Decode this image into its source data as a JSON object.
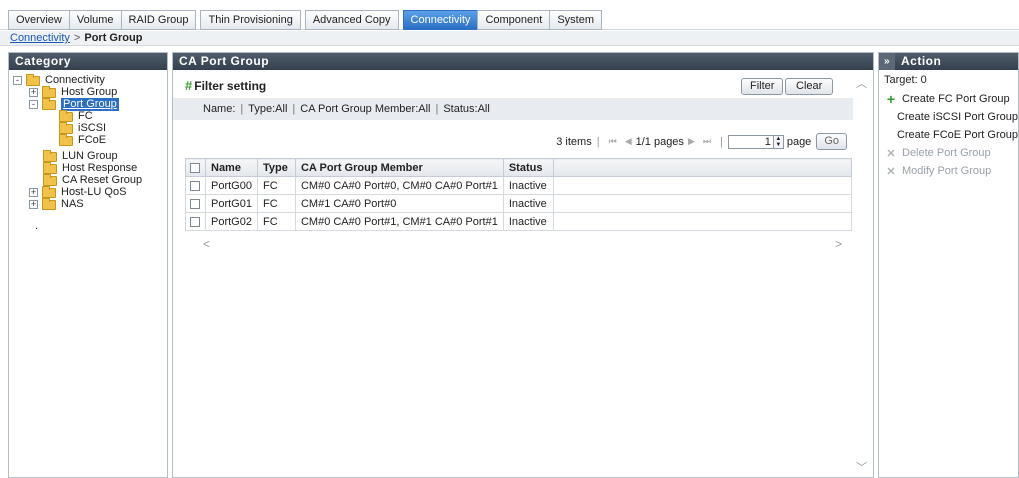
{
  "tabs": [
    {
      "label": "Overview"
    },
    {
      "label": "Volume"
    },
    {
      "label": "RAID Group"
    },
    {
      "label": "Thin Provisioning"
    },
    {
      "label": "Advanced Copy"
    },
    {
      "label": "Connectivity",
      "active": true
    },
    {
      "label": "Component"
    },
    {
      "label": "System"
    }
  ],
  "breadcrumb": {
    "parent": "Connectivity",
    "separator": ">",
    "current": "Port Group"
  },
  "category": {
    "title": "Category",
    "tree": [
      {
        "label": "Connectivity",
        "toggle": "-",
        "level": 0
      },
      {
        "label": "Host Group",
        "toggle": "+",
        "level": 1
      },
      {
        "label": "Port Group",
        "toggle": "-",
        "level": 1,
        "selected": true
      },
      {
        "label": "FC",
        "level": 2
      },
      {
        "label": "iSCSI",
        "level": 2
      },
      {
        "label": "FCoE",
        "level": 2
      },
      {
        "label": "LUN Group",
        "level": 1
      },
      {
        "label": "Host Response",
        "level": 1
      },
      {
        "label": "CA Reset Group",
        "level": 1
      },
      {
        "label": "Host-LU QoS",
        "toggle": "+",
        "level": 1
      },
      {
        "label": "NAS",
        "toggle": "+",
        "level": 1
      }
    ],
    "stray_dot": "."
  },
  "main": {
    "title": "CA Port Group",
    "filter": {
      "label": "Filter setting",
      "filter_button": "Filter",
      "clear_button": "Clear",
      "summary": [
        "Name:",
        "Type:All",
        "CA Port Group Member:All",
        "Status:All"
      ]
    },
    "pager": {
      "items": "3 items",
      "pages": "1/1 pages",
      "page_value": "1",
      "page_label": "page",
      "go_label": "Go"
    },
    "table": {
      "columns": [
        "Name",
        "Type",
        "CA Port Group Member",
        "Status"
      ],
      "rows": [
        [
          "PortG00",
          "FC",
          "CM#0 CA#0 Port#0, CM#0 CA#0 Port#1",
          "Inactive"
        ],
        [
          "PortG01",
          "FC",
          "CM#1 CA#0 Port#0",
          "Inactive"
        ],
        [
          "PortG02",
          "FC",
          "CM#0 CA#0 Port#1, CM#1 CA#0 Port#1",
          "Inactive"
        ]
      ]
    }
  },
  "action": {
    "collapse_label": "»",
    "title": "Action",
    "target": "Target: 0",
    "items": [
      {
        "label": "Create FC Port Group",
        "icon": "+",
        "enabled": true
      },
      {
        "label": "Create iSCSI Port Group",
        "icon": "",
        "enabled": true
      },
      {
        "label": "Create FCoE Port Group",
        "icon": "",
        "enabled": true
      },
      {
        "label": "Delete Port Group",
        "icon": "✕",
        "enabled": false
      },
      {
        "label": "Modify Port Group",
        "icon": "✕",
        "enabled": false
      }
    ]
  },
  "colors": {
    "active_tab": "#2b6fc4",
    "header_bg": "#3e4a58",
    "folder": "#f1c24a",
    "plus": "#2e9b2e"
  }
}
